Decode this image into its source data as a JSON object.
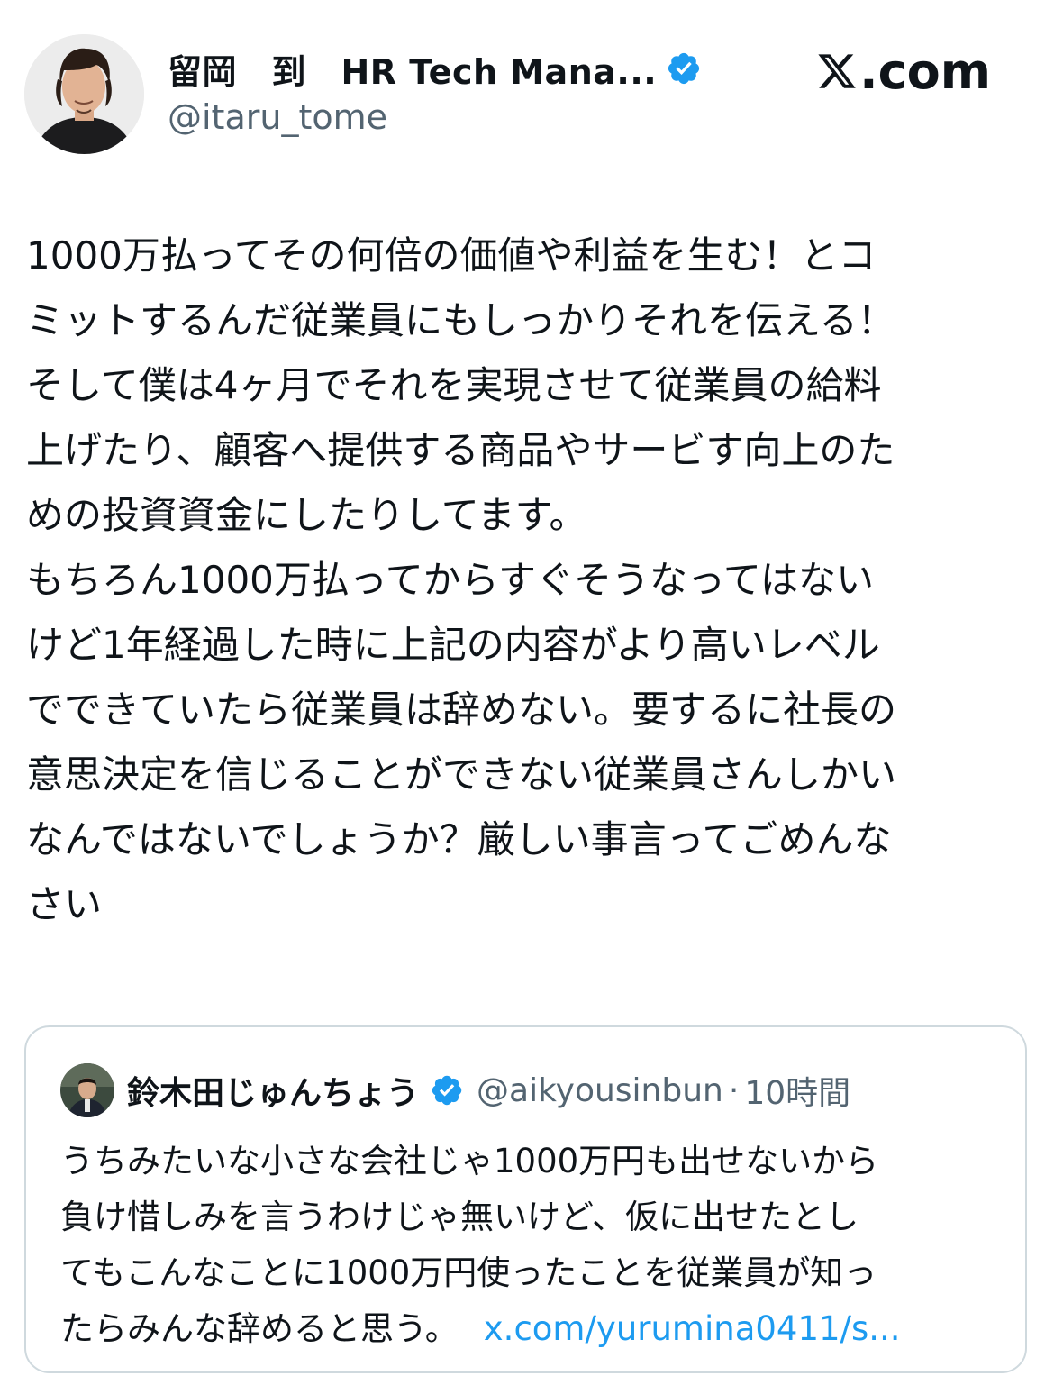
{
  "header": {
    "display_name": "留岡　到　HR Tech Mana...",
    "handle": "@itaru_tome",
    "brand": ".com",
    "icons": [
      "profile-avatar",
      "verified-badge-icon",
      "x-logo-icon"
    ]
  },
  "tweet": {
    "lines": [
      "1000万払ってその何倍の価値や利益を生む！とコ",
      "ミットするんだ従業員にもしっかりそれを伝える！",
      "そして僕は4ヶ月でそれを実現させて従業員の給料",
      "上げたり、顧客へ提供する商品やサービす向上のた",
      "めの投資資金にしたりしてます。",
      "もちろん1000万払ってからすぐそうなってはない",
      "けど1年経過した時に上記の内容がより高いレベル",
      "でできていたら従業員は辞めない。要するに社長の",
      "意思決定を信じることができない従業員さんしかい",
      "なんではないでしょうか？厳しい事言ってごめんな",
      "さい"
    ]
  },
  "quote": {
    "display_name": "鈴木田じゅんちょう",
    "handle": "@aikyousinbun",
    "separator": "·",
    "time": "10時間",
    "lines": [
      "うちみたいな小さな会社じゃ1000万円も出せないから",
      "負け惜しみを言うわけじゃ無いけど、仮に出せたとし",
      "てもこんなことに1000万円使ったことを従業員が知っ",
      "たらみんな辞めると思う。"
    ],
    "link_text": "x.com/yurumina0411/s..."
  },
  "colors": {
    "text": "#0f1419",
    "secondary": "#536471",
    "link": "#1d9bf0",
    "verified": "#1d9bf0",
    "border": "#cfd9de"
  }
}
